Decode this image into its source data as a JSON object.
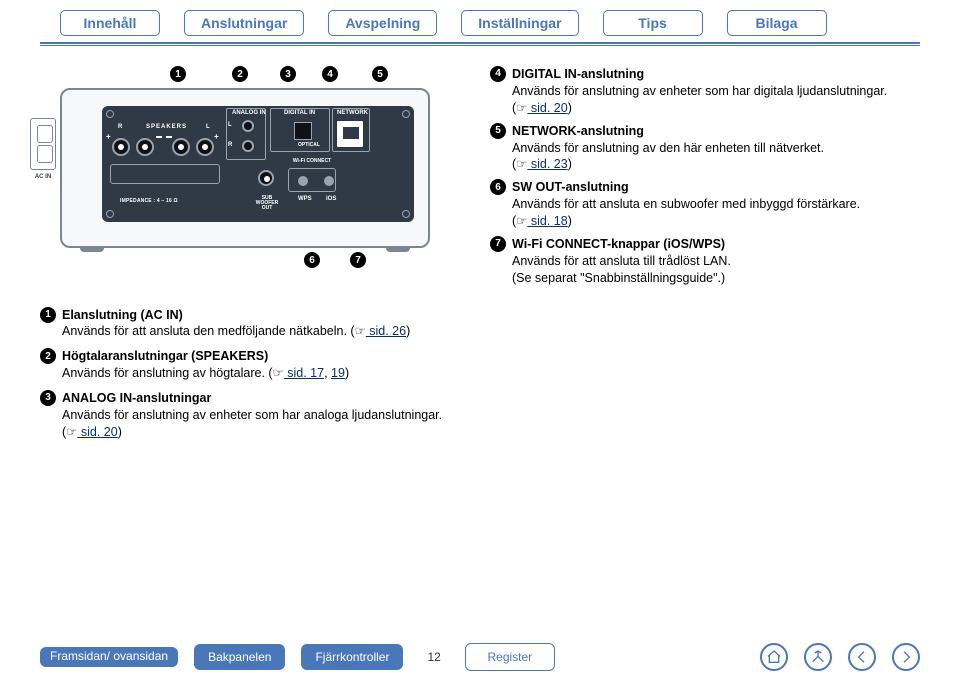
{
  "topnav": {
    "tabs": [
      "Innehåll",
      "Anslutningar",
      "Avspelning",
      "Inställningar",
      "Tips",
      "Bilaga"
    ]
  },
  "callouts_top": [
    "1",
    "2",
    "3",
    "4",
    "5"
  ],
  "callouts_bottom": [
    "6",
    "7"
  ],
  "device": {
    "analog_in": "ANALOG IN",
    "digital_in": "DIGITAL IN",
    "network": "NETWORK",
    "speakers": "SPEAKERS",
    "R": "R",
    "L": "L",
    "optical": "OPTICAL",
    "wifi": "Wi-Fi CONNECT",
    "wps": "WPS",
    "ios": "iOS",
    "sub": "SUB WOOFER OUT",
    "impedance": "IMPEDANCE : 4 – 16 Ω",
    "ac_in": "AC IN"
  },
  "right_items": [
    {
      "num": "4",
      "title": "DIGITAL IN-anslutning",
      "body": "Används för anslutning av enheter som har digitala ljudanslutningar.",
      "ref_prefix": "(",
      "hand": "☞",
      "ref": " sid. 20",
      "ref_suffix": ")"
    },
    {
      "num": "5",
      "title": "NETWORK-anslutning",
      "body": "Används för anslutning av den här enheten till nätverket.",
      "ref_prefix": "(",
      "hand": "☞",
      "ref": " sid. 23",
      "ref_suffix": ")"
    },
    {
      "num": "6",
      "title": "SW OUT-anslutning",
      "body": "Används för att ansluta en subwoofer med inbyggd förstärkare.",
      "ref_prefix": "(",
      "hand": "☞",
      "ref": " sid. 18",
      "ref_suffix": ")"
    },
    {
      "num": "7",
      "title": "Wi-Fi CONNECT-knappar (iOS/WPS)",
      "body": "Används för att ansluta till trådlöst LAN.",
      "note": "(Se separat \"Snabbinställningsguide\".)"
    }
  ],
  "left_items": [
    {
      "num": "1",
      "title": "Elanslutning (AC IN)",
      "body": "Används för att ansluta den medföljande nätkabeln. (",
      "hand": "☞",
      "ref": " sid. 26",
      "suffix": ")"
    },
    {
      "num": "2",
      "title": "Högtalaranslutningar (SPEAKERS)",
      "body": "Används för anslutning av högtalare. (",
      "hand": "☞",
      "ref": " sid. 17",
      "ref2": "19",
      "mid": ", ",
      "suffix": ")"
    },
    {
      "num": "3",
      "title": "ANALOG IN-anslutningar",
      "body": "Används för anslutning av enheter som har analoga ljudanslutningar.",
      "ref_prefix": "(",
      "hand": "☞",
      "ref": " sid. 20",
      "suffix": ")"
    }
  ],
  "bottomnav": {
    "front": "Framsidan/ ovansidan",
    "back": "Bakpanelen",
    "remote": "Fjärrkontroller",
    "register": "Register",
    "page": "12"
  }
}
